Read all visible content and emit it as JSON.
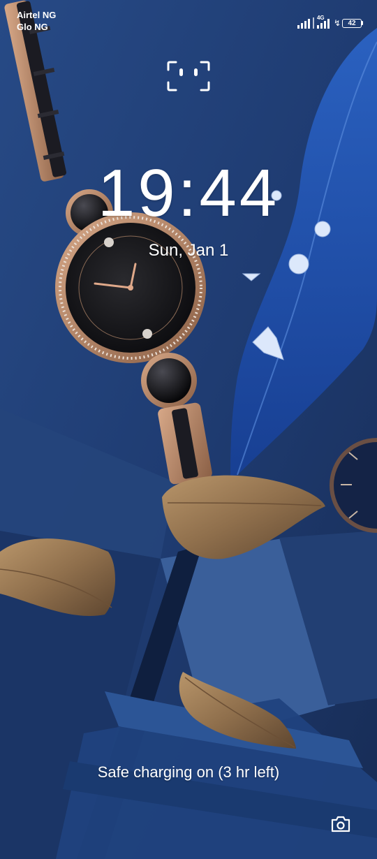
{
  "status_bar": {
    "carriers": [
      "Airtel NG",
      "Glo NG"
    ],
    "network_type": "4G",
    "battery_level": "42",
    "charging": true
  },
  "lock_screen": {
    "time": "19:44",
    "date": "Sun, Jan 1",
    "charging_status": "Safe charging on (3 hr left)"
  },
  "icons": {
    "face_unlock": "face-unlock-icon",
    "camera": "camera-icon",
    "signal": "signal-icon",
    "battery": "battery-icon",
    "charging": "lightning-bolt-icon"
  },
  "colors": {
    "text": "#ffffff",
    "wallpaper_base": "#1d3565"
  }
}
